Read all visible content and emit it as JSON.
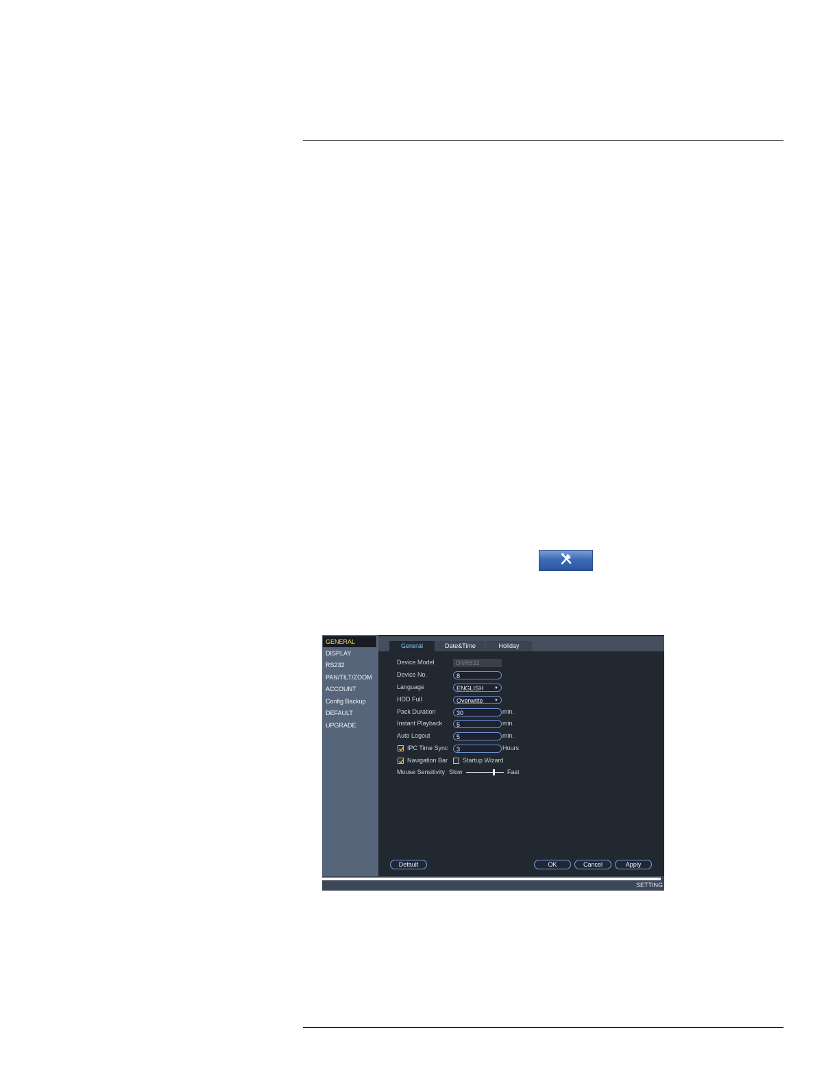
{
  "toolbar_button": {
    "icon": "tools-icon"
  },
  "sidebar": {
    "items": [
      {
        "label": "GENERAL",
        "active": true
      },
      {
        "label": "DISPLAY"
      },
      {
        "label": "RS232"
      },
      {
        "label": "PAN/TILT/ZOOM"
      },
      {
        "label": "ACCOUNT"
      },
      {
        "label": "Config Backup"
      },
      {
        "label": "DEFAULT"
      },
      {
        "label": "UPGRADE"
      }
    ]
  },
  "tabs": [
    {
      "label": "General",
      "active": true
    },
    {
      "label": "Date&Time"
    },
    {
      "label": "Holiday"
    }
  ],
  "form": {
    "device_model": {
      "label": "Device Model",
      "value": "DNR832"
    },
    "device_no": {
      "label": "Device No.",
      "value": "8"
    },
    "language": {
      "label": "Language",
      "value": "ENGLISH"
    },
    "hdd_full": {
      "label": "HDD Full",
      "value": "Overwrite"
    },
    "pack_duration": {
      "label": "Pack Duration",
      "value": "30",
      "unit": "min."
    },
    "instant_playback": {
      "label": "Instant Playback",
      "value": "5",
      "unit": "min."
    },
    "auto_logout": {
      "label": "Auto Logout",
      "value": "5",
      "unit": "min."
    },
    "ipc_time_sync": {
      "label": "IPC Time Sync",
      "checked": true,
      "value": "3",
      "unit": "Hours"
    },
    "navigation_bar": {
      "label": "Navigation Bar",
      "checked": true
    },
    "startup_wizard": {
      "label": "Startup Wizard",
      "checked": false
    },
    "mouse_sensitivity": {
      "label": "Mouse Sensitivity",
      "slow": "Slow",
      "fast": "Fast",
      "level": 0.75
    }
  },
  "buttons": {
    "default": "Default",
    "ok": "OK",
    "cancel": "Cancel",
    "apply": "Apply"
  },
  "status": {
    "text": "SETTING",
    "progress": 0.99
  },
  "colors": {
    "accent_yellow": "#f4d35e",
    "active_tab_text": "#7fc7ff",
    "field_border": "#6e8fd6"
  }
}
